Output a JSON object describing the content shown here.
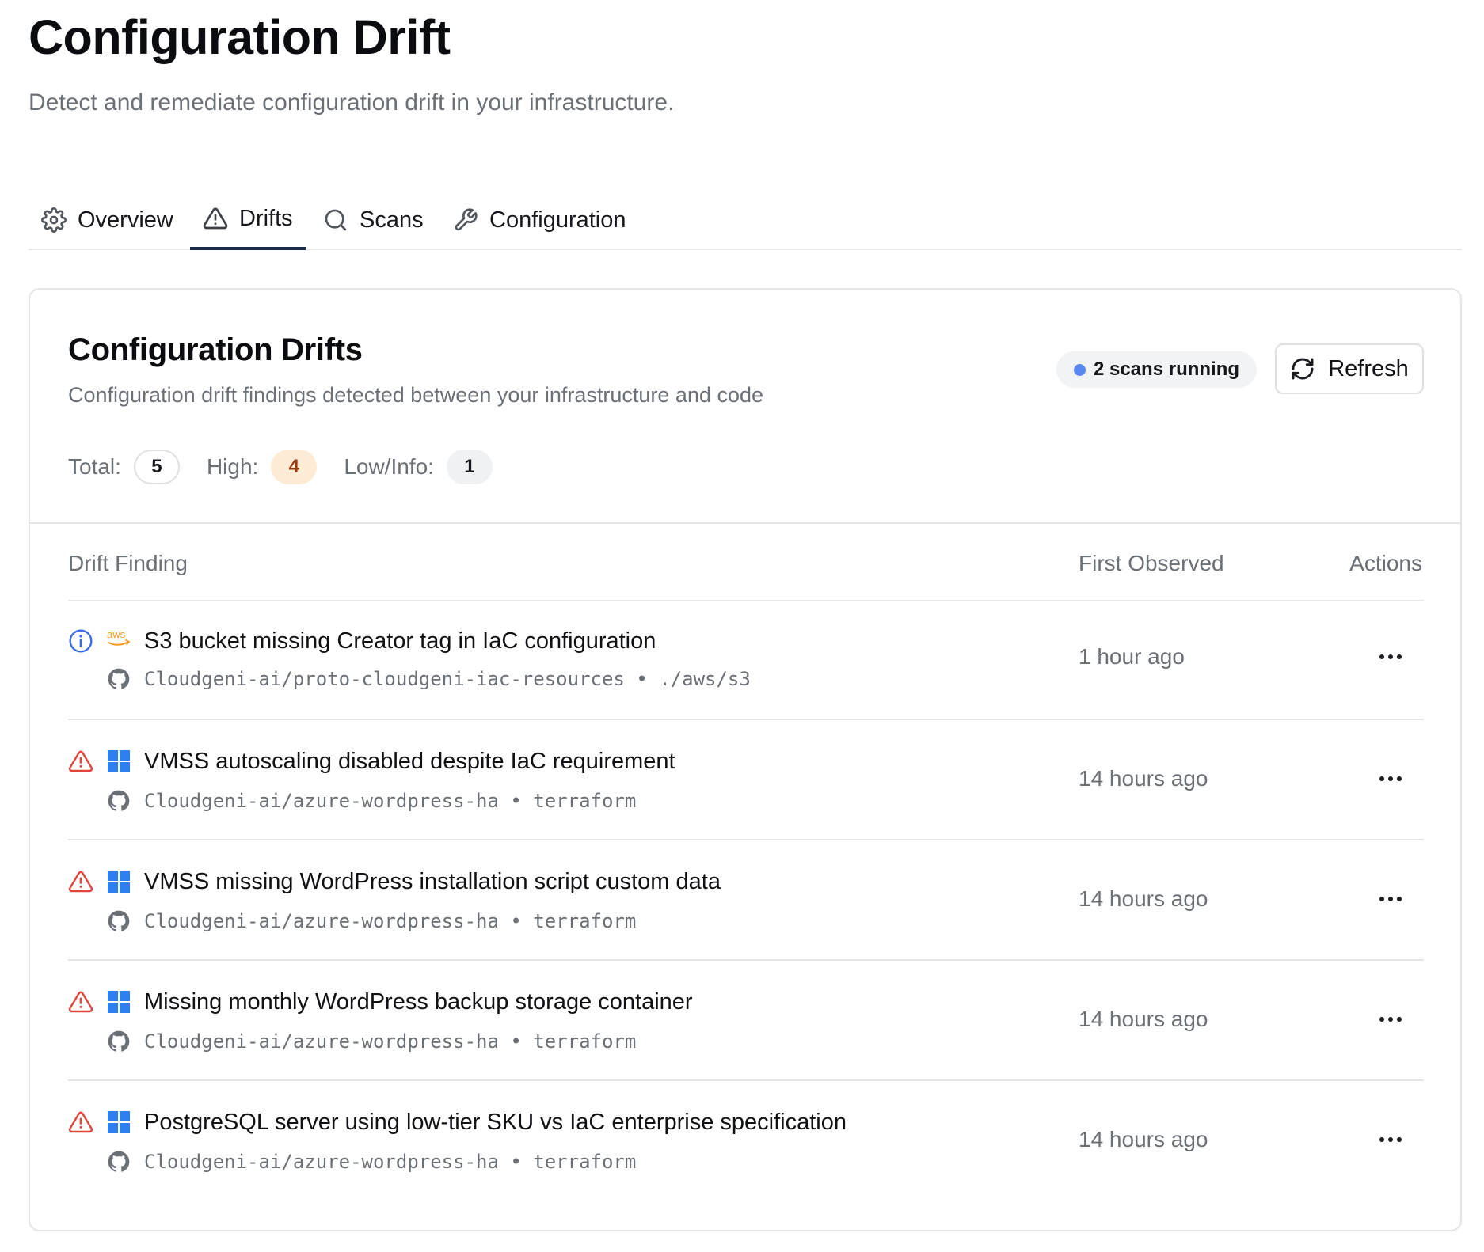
{
  "page": {
    "title": "Configuration Drift",
    "subtitle": "Detect and remediate configuration drift in your infrastructure."
  },
  "tabs": [
    {
      "label": "Overview",
      "icon": "gear-icon",
      "active": false
    },
    {
      "label": "Drifts",
      "icon": "warning-triangle-icon",
      "active": true
    },
    {
      "label": "Scans",
      "icon": "search-icon",
      "active": false
    },
    {
      "label": "Configuration",
      "icon": "wrench-icon",
      "active": false
    }
  ],
  "card": {
    "title": "Configuration Drifts",
    "description": "Configuration drift findings detected between your infrastructure and code",
    "scan_status": "2 scans running",
    "refresh_label": "Refresh",
    "counts": {
      "total_label": "Total:",
      "total": "5",
      "high_label": "High:",
      "high": "4",
      "low_label": "Low/Info:",
      "low": "1"
    },
    "columns": {
      "finding": "Drift Finding",
      "first_observed": "First Observed",
      "actions": "Actions"
    },
    "rows": [
      {
        "severity": "info",
        "provider": "aws",
        "title": "S3 bucket missing Creator tag in IaC configuration",
        "meta": "Cloudgeni-ai/proto-cloudgeni-iac-resources • ./aws/s3",
        "first_observed": "1 hour ago"
      },
      {
        "severity": "high",
        "provider": "azure",
        "title": "VMSS autoscaling disabled despite IaC requirement",
        "meta": "Cloudgeni-ai/azure-wordpress-ha • terraform",
        "first_observed": "14 hours ago"
      },
      {
        "severity": "high",
        "provider": "azure",
        "title": "VMSS missing WordPress installation script custom data",
        "meta": "Cloudgeni-ai/azure-wordpress-ha • terraform",
        "first_observed": "14 hours ago"
      },
      {
        "severity": "high",
        "provider": "azure",
        "title": "Missing monthly WordPress backup storage container",
        "meta": "Cloudgeni-ai/azure-wordpress-ha • terraform",
        "first_observed": "14 hours ago"
      },
      {
        "severity": "high",
        "provider": "azure",
        "title": "PostgreSQL server using low-tier SKU vs IaC enterprise specification",
        "meta": "Cloudgeni-ai/azure-wordpress-ha • terraform",
        "first_observed": "14 hours ago"
      }
    ]
  },
  "colors": {
    "info": "#3b6be6",
    "high": "#e0453a",
    "azure": "#2f7ff0",
    "aws": "#f29a1a",
    "scan_dot": "#5b87f0"
  }
}
